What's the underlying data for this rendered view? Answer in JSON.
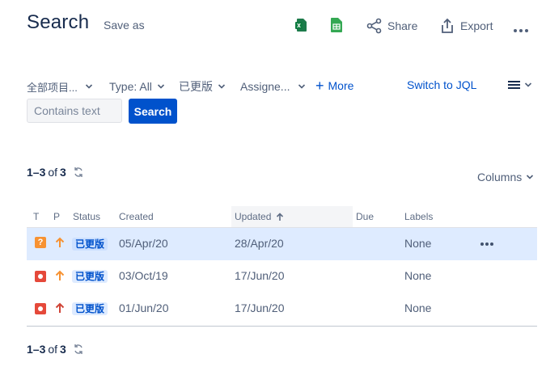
{
  "header": {
    "title": "Search",
    "save_as": "Save as",
    "share": "Share",
    "export": "Export",
    "excel_icon_color": "#1d7b4b",
    "sheets_icon_color": "#34a853"
  },
  "filters": {
    "project": "全部项目...",
    "type": "Type: All",
    "status": "已更版",
    "assignee": "Assigne...",
    "more": "More",
    "switch_jql": "Switch to JQL"
  },
  "search": {
    "placeholder": "Contains text",
    "button": "Search"
  },
  "results": {
    "range": "1–3",
    "of": "of",
    "total": "3",
    "columns_label": "Columns"
  },
  "table": {
    "headers": {
      "t": "T",
      "p": "P",
      "status": "Status",
      "created": "Created",
      "updated": "Updated",
      "due": "Due",
      "labels": "Labels"
    },
    "rows": [
      {
        "type": "question-icon",
        "priority": "priority-medium-icon",
        "status": "已更版",
        "created": "05/Apr/20",
        "updated": "28/Apr/20",
        "due": "",
        "labels": "None",
        "selected": true
      },
      {
        "type": "bug-icon",
        "priority": "priority-medium-icon",
        "status": "已更版",
        "created": "03/Oct/19",
        "updated": "17/Jun/20",
        "due": "",
        "labels": "None",
        "selected": false
      },
      {
        "type": "bug-icon",
        "priority": "priority-high-icon",
        "status": "已更版",
        "created": "01/Jun/20",
        "updated": "17/Jun/20",
        "due": "",
        "labels": "None",
        "selected": false
      }
    ]
  },
  "footer": {
    "range": "1–3",
    "of": "of",
    "total": "3"
  },
  "colors": {
    "accent": "#0052cc",
    "selected_row": "#deebff",
    "question": "#f79232",
    "bug": "#e5493a",
    "priority_medium": "#f79232",
    "priority_high": "#d04437"
  }
}
